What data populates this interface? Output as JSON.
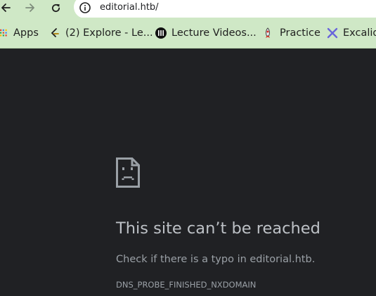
{
  "toolbar": {
    "url": "editorial.htb/"
  },
  "bookmarks": [
    {
      "label": "Apps",
      "icon": "apps-grid-icon"
    },
    {
      "label": "(2) Explore - Le...",
      "icon": "leetcode-icon"
    },
    {
      "label": "Lecture Videos...",
      "icon": "mit-ocw-icon"
    },
    {
      "label": "Practice",
      "icon": "practice-rocket-icon"
    },
    {
      "label": "Excalid",
      "icon": "excalidraw-icon"
    }
  ],
  "error": {
    "title": "This site can’t be reached",
    "message": "Check if there is a typo in editorial.htb.",
    "code": "DNS_PROBE_FINISHED_NXDOMAIN"
  },
  "colors": {
    "chrome_bg": "#cfe8c6",
    "page_bg": "#202124",
    "title_text": "#bdc1c6",
    "body_text": "#9aa0a6"
  }
}
